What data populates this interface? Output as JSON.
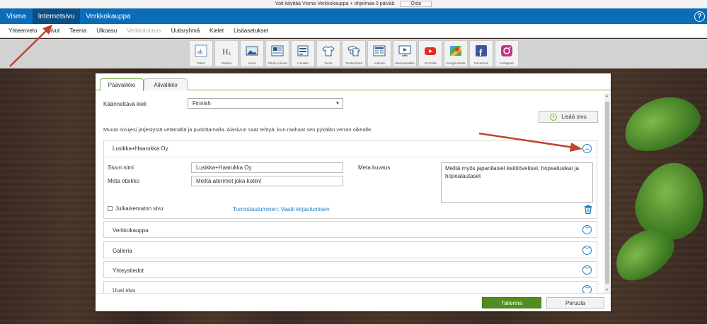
{
  "trial": {
    "text": "Voit käyttää Visma Verkkokauppa + ohjelmaa 0 päivää",
    "buy_label": "Osta"
  },
  "topnav": {
    "brand": "Visma",
    "tabs": [
      "Internetsivu",
      "Verkkokauppa"
    ],
    "help": "?"
  },
  "subnav": {
    "items": [
      "Yhteenveto",
      "Sivut",
      "Teema",
      "Ulkoasu",
      "Verkkotunnus",
      "Uutisryhmä",
      "Kielet",
      "Lisäasetukset"
    ]
  },
  "tools": [
    {
      "label": "Teksti",
      "icon": "text-icon"
    },
    {
      "label": "Otsikko",
      "icon": "heading-icon"
    },
    {
      "label": "Kuva",
      "icon": "image-icon"
    },
    {
      "label": "Teksti ja kuva",
      "icon": "text-image-icon"
    },
    {
      "label": "Lomake",
      "icon": "form-icon"
    },
    {
      "label": "Tuote",
      "icon": "product-icon"
    },
    {
      "label": "Tuoteryhmä",
      "icon": "product-group-icon"
    },
    {
      "label": "Uutinen",
      "icon": "news-icon"
    },
    {
      "label": "Mainospaikka",
      "icon": "ad-icon"
    },
    {
      "label": "YouTube",
      "icon": "youtube-icon"
    },
    {
      "label": "Google kartta",
      "icon": "map-icon"
    },
    {
      "label": "Facebook",
      "icon": "facebook-icon"
    },
    {
      "label": "Instagram",
      "icon": "instagram-icon"
    }
  ],
  "dialog": {
    "tabs": [
      "Päävalikko",
      "Alivalikko"
    ],
    "lang_label": "Käännettävä kieli",
    "lang_value": "Finnish",
    "add_page": "Lisää sivu",
    "hint": "Muuta sivujesi järjestystä vetämällä ja pudottamalla. Alasivun saat tehtyä, kun raahaat sen pykälän verran oikealle.",
    "main_panel": {
      "title": "Lusikka+Haarukka Oy",
      "page_name_label": "Sivun nimi",
      "page_name_value": "Lusikka+Haarukka Oy",
      "meta_title_label": "Meta otsikko",
      "meta_title_value": "Meiltä aterimet joka kotiin!",
      "meta_desc_label": "Meta kuvaus",
      "meta_desc_value": "Meiltä myös japanilaiset keittiöveitset, hopealusikat ja hopealautaset",
      "unpublished_label": "Julkaisematon sivu",
      "auth_text": "Tunnistautuminen: Vaatii kirjautumisen"
    },
    "panels": [
      "Verkkokauppa",
      "Galleria",
      "Yhteystiedot",
      "Uusi sivu"
    ],
    "save": "Tallenna",
    "cancel": "Peruuta"
  },
  "colors": {
    "brand_blue": "#0b6cb8",
    "active_blue": "#0a4f86",
    "accent_green": "#4f8f1f",
    "link_blue": "#1e7fc4",
    "annotation_red": "#c0432c"
  }
}
